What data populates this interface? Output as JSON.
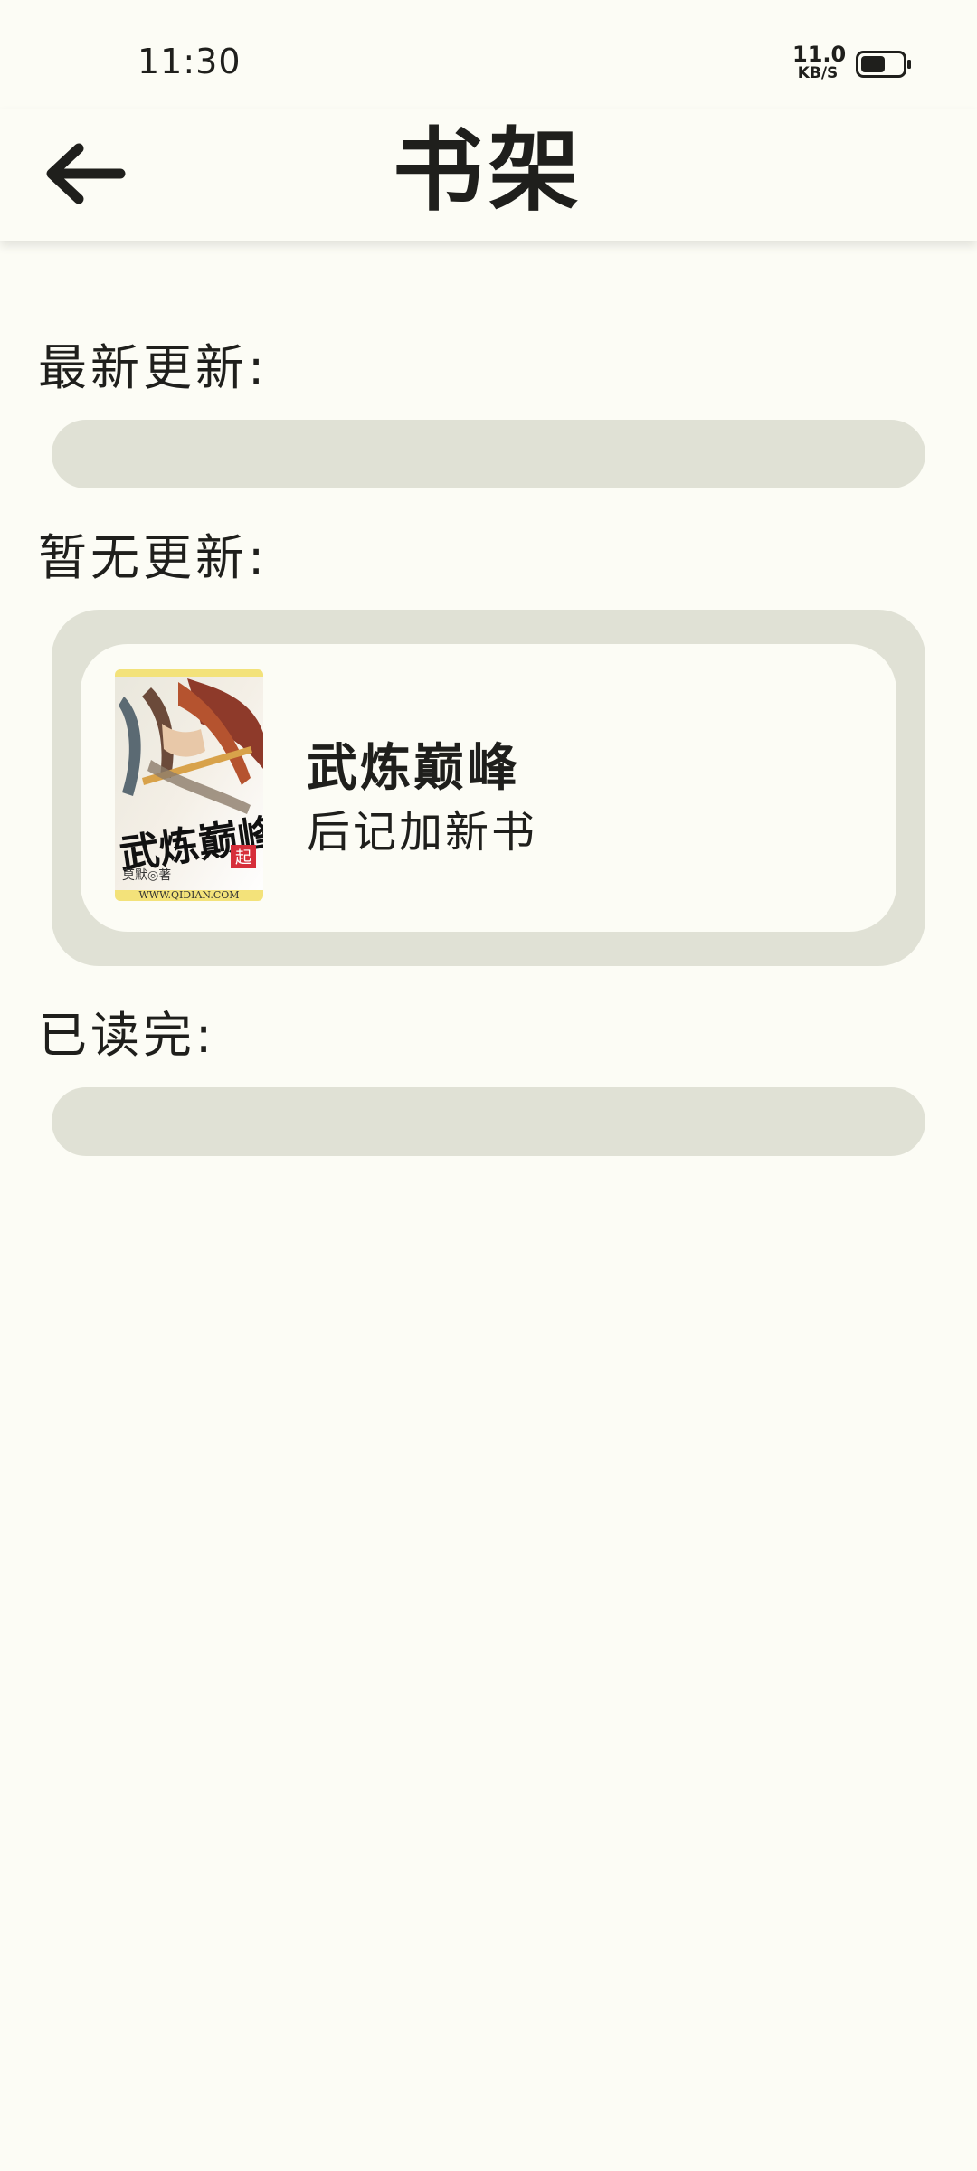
{
  "status_bar": {
    "time": "11:30",
    "net_speed_value": "11.0",
    "net_speed_unit": "KB/S",
    "battery_level": 0.6
  },
  "header": {
    "back_icon": "arrow-left-icon",
    "title": "书架"
  },
  "sections": {
    "latest_label": "最新更新:",
    "no_update_label": "暂无更新:",
    "finished_label": "已读完:"
  },
  "book": {
    "title": "武炼巅峰",
    "subtitle": "后记加新书",
    "cover": {
      "title_text": "武炼巅峰",
      "author_text": "莫默◎著",
      "site_text": "WWW.QIDIAN.COM",
      "badge_text": "起"
    }
  },
  "colors": {
    "background": "#fcfcf5",
    "shelf": "#e0e1d5",
    "text": "#1f1f1c"
  }
}
